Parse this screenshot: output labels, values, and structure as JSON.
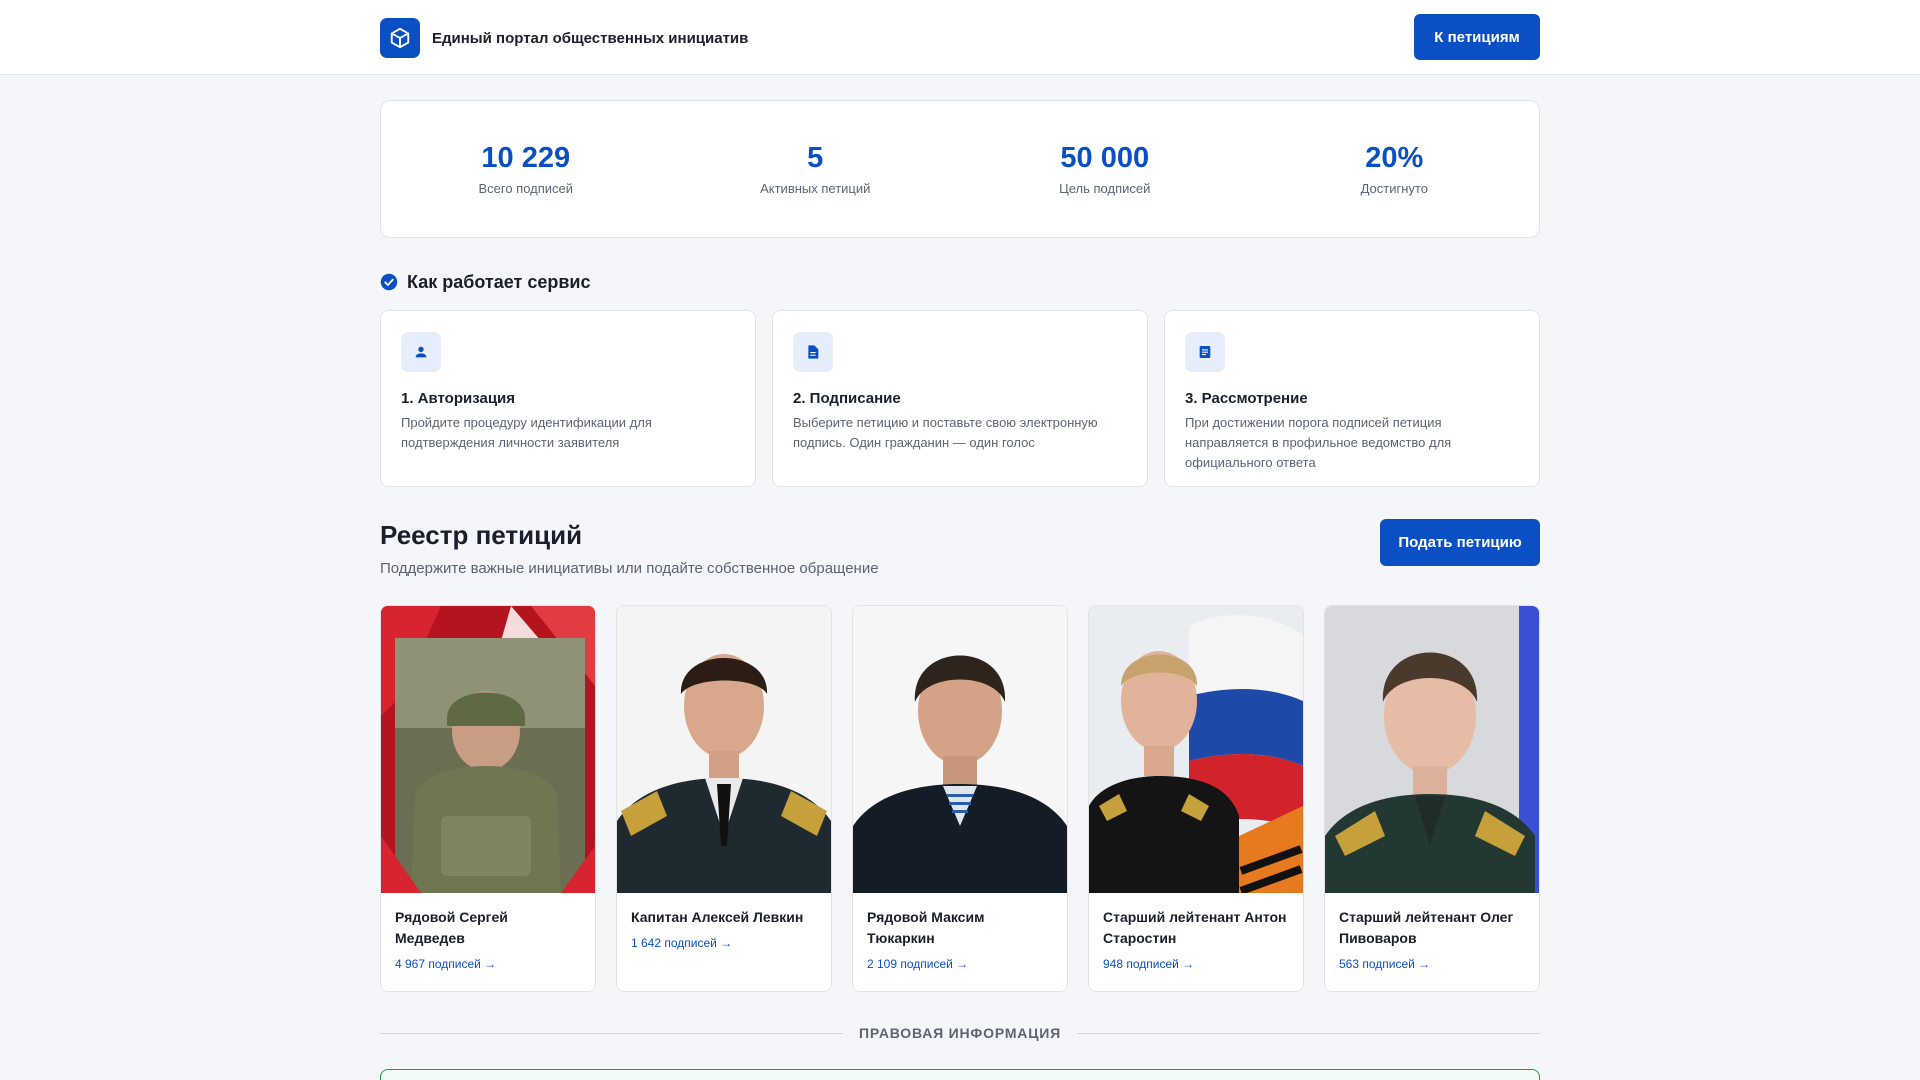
{
  "header": {
    "title": "Единый портал общественных инициатив",
    "cta_label": "К петициям",
    "logo_icon": "cube-icon"
  },
  "stats": [
    {
      "value": "10 229",
      "label": "Всего подписей"
    },
    {
      "value": "5",
      "label": "Активных петиций"
    },
    {
      "value": "50 000",
      "label": "Цель подписей"
    },
    {
      "value": "20%",
      "label": "Достигнуто"
    }
  ],
  "how": {
    "title": "Как работает сервис",
    "steps": [
      {
        "icon": "person-icon",
        "title": "1. Авторизация",
        "text": "Пройдите процедуру идентификации для подтверждения личности заявителя"
      },
      {
        "icon": "document-icon",
        "title": "2. Подписание",
        "text": "Выберите петицию и поставьте свою электронную подпись. Один гражданин — один голос"
      },
      {
        "icon": "list-icon",
        "title": "3. Рассмотрение",
        "text": "При достижении порога подписей петиция направляется в профильное ведомство для официального ответа"
      }
    ]
  },
  "registry": {
    "title": "Реестр петиций",
    "subtitle": "Поддержите важные инициативы или подайте собственное обращение",
    "submit_label": "Подать петицию",
    "petitions": [
      {
        "name": "Рядовой Сергей Медведев",
        "signatures": "4 967 подписей →"
      },
      {
        "name": "Капитан Алексей Левкин",
        "signatures": "1 642 подписей →"
      },
      {
        "name": "Рядовой Максим Тюкаркин",
        "signatures": "2 109 подписей →"
      },
      {
        "name": "Старший лейтенант Антон Старостин",
        "signatures": "948 подписей →"
      },
      {
        "name": "Старший лейтенант Олег Пивоваров",
        "signatures": "563 подписей →"
      }
    ]
  },
  "legal": {
    "title": "ПРАВОВАЯ ИНФОРМАЦИЯ"
  },
  "colors": {
    "accent": "#0b4fc4",
    "legal_border": "#1f9d55"
  }
}
